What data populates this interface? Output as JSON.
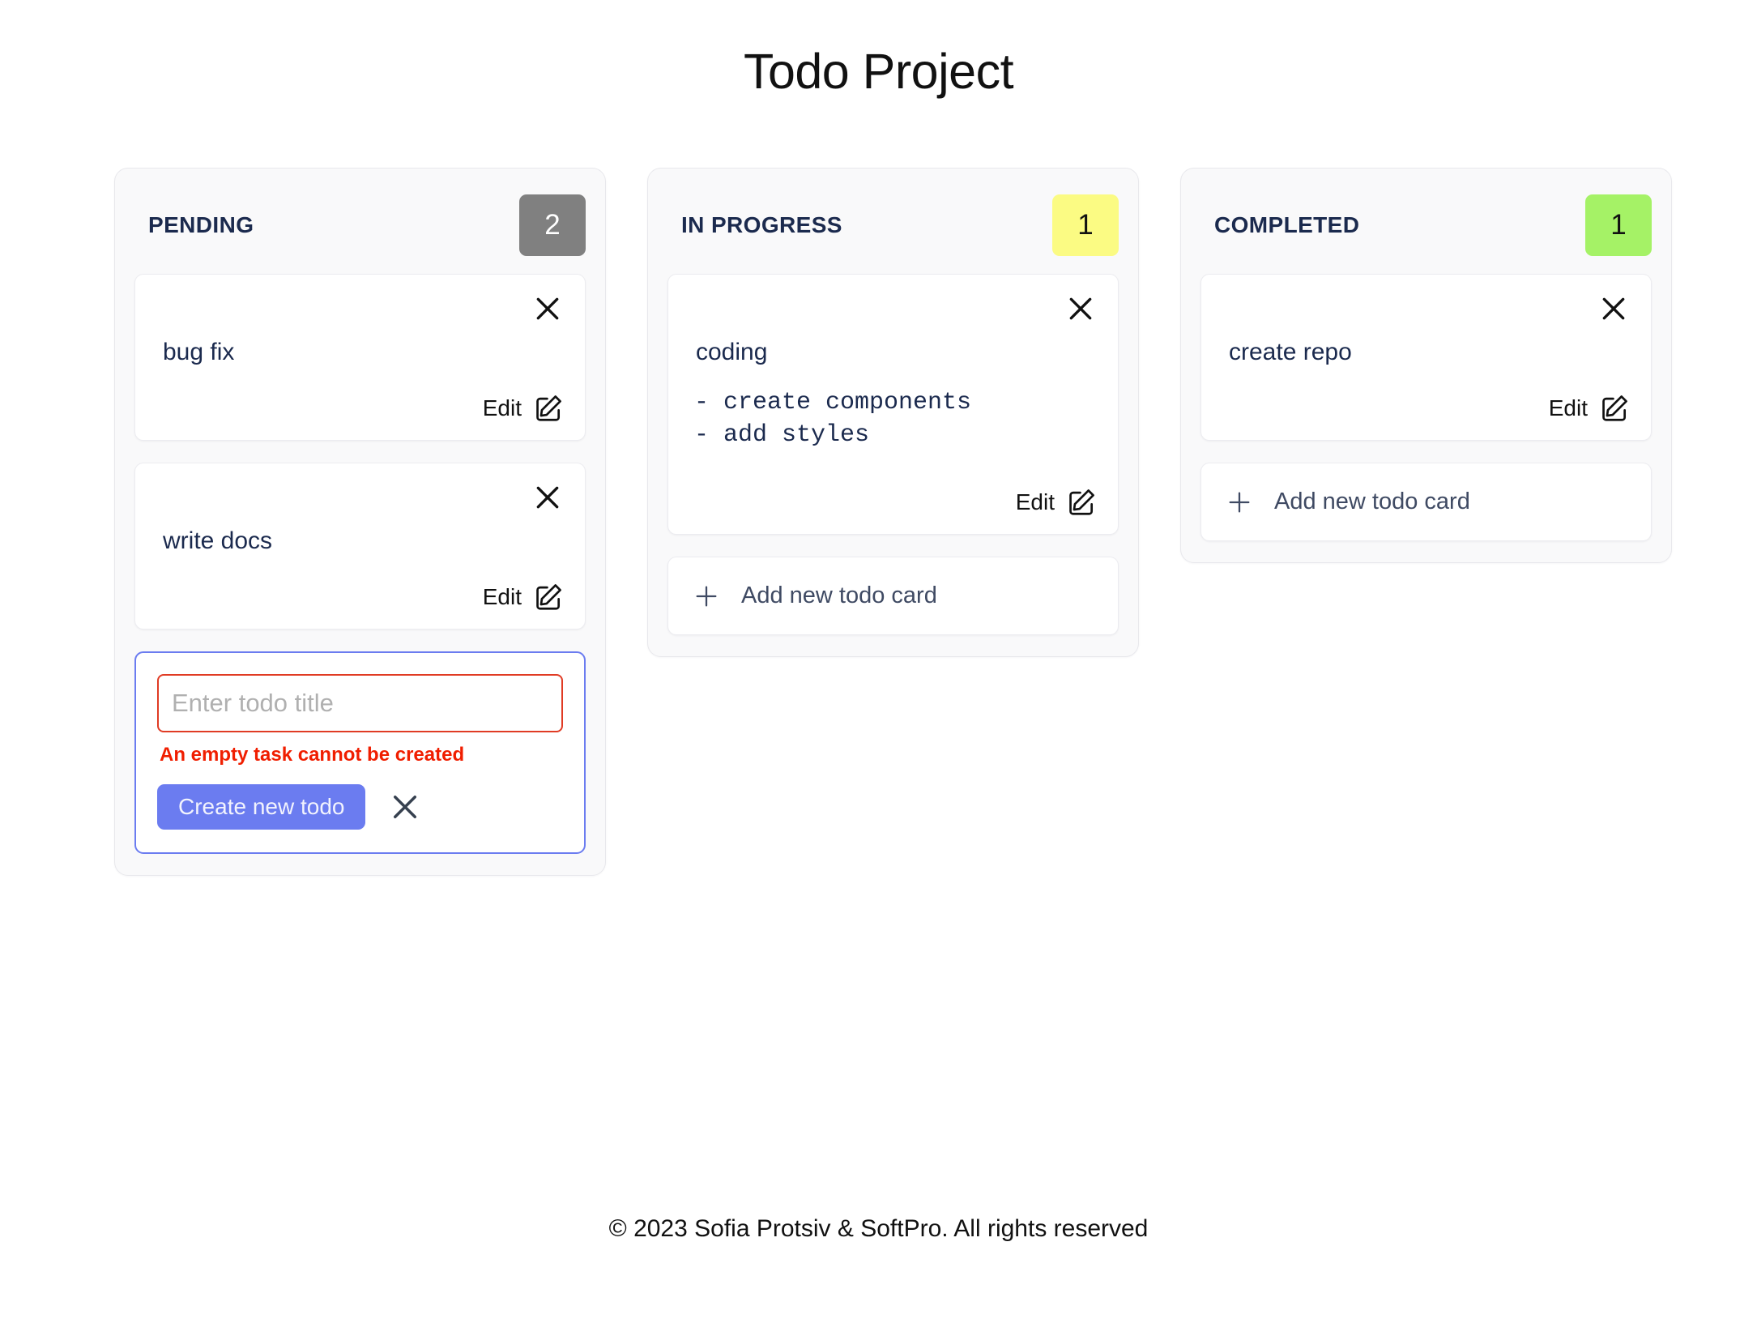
{
  "header": {
    "title": "Todo Project"
  },
  "icons": {
    "close": "close-icon",
    "edit": "edit-pencil-icon",
    "plus": "plus-icon",
    "resize": "resize-grip-icon"
  },
  "colors": {
    "badge_pending": "#808080",
    "badge_in_progress": "#fbfb83",
    "badge_completed": "#a5f266",
    "primary_button": "#6b7cf0",
    "error": "#f01e00",
    "input_error_border": "#e03b24",
    "text_dark": "#1b2a4e"
  },
  "labels": {
    "edit": "Edit",
    "add_new_card": "Add new todo card"
  },
  "columns": [
    {
      "id": "pending",
      "title": "PENDING",
      "count": "2",
      "badge_style": "badge-gray",
      "cards": [
        {
          "title": "bug fix",
          "body": "",
          "edit_label": "Edit"
        },
        {
          "title": "write docs",
          "body": "",
          "edit_label": "Edit"
        }
      ],
      "add_label": "Add new todo card",
      "show_add_button": false,
      "show_form": true,
      "form": {
        "input_value": "",
        "placeholder": "Enter todo title",
        "error": "An empty task cannot be created",
        "submit_label": "Create new todo"
      }
    },
    {
      "id": "in-progress",
      "title": "IN PROGRESS",
      "count": "1",
      "badge_style": "badge-yellow",
      "cards": [
        {
          "title": "coding",
          "body": "- create components\n- add styles",
          "edit_label": "Edit"
        }
      ],
      "add_label": "Add new todo card",
      "show_add_button": true,
      "show_form": false
    },
    {
      "id": "completed",
      "title": "COMPLETED",
      "count": "1",
      "badge_style": "badge-green",
      "cards": [
        {
          "title": "create repo",
          "body": "",
          "edit_label": "Edit"
        }
      ],
      "add_label": "Add new todo card",
      "show_add_button": true,
      "show_form": false
    }
  ],
  "footer": {
    "text": "© 2023 Sofia Protsiv & SoftPro. All rights reserved"
  }
}
